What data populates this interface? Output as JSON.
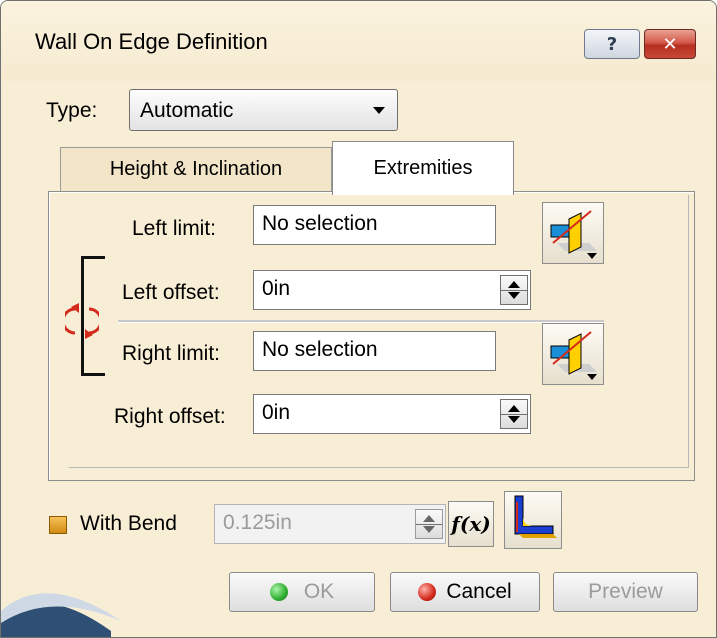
{
  "window": {
    "title": "Wall On Edge Definition",
    "help_label": "?",
    "close_label": "✕"
  },
  "type_row": {
    "label": "Type:",
    "selected": "Automatic"
  },
  "tabs": [
    {
      "label": "Height & Inclination",
      "active": false
    },
    {
      "label": "Extremities",
      "active": true
    }
  ],
  "extremities": {
    "left_limit_label": "Left limit:",
    "left_limit_value": "No selection",
    "left_offset_label": "Left offset:",
    "left_offset_value": "0in",
    "right_limit_label": "Right limit:",
    "right_limit_value": "No selection",
    "right_offset_label": "Right offset:",
    "right_offset_value": "0in"
  },
  "bend": {
    "label": "With Bend",
    "checked": true,
    "radius_value": "0.125in",
    "formula_label": "f(x)"
  },
  "footer": {
    "ok_label": "OK",
    "cancel_label": "Cancel",
    "preview_label": "Preview"
  },
  "colors": {
    "background": "#f8eed5",
    "ok_dot": "#2fae2f",
    "cancel_dot": "#d42a1c",
    "swap_icon": "#d42a1c"
  }
}
